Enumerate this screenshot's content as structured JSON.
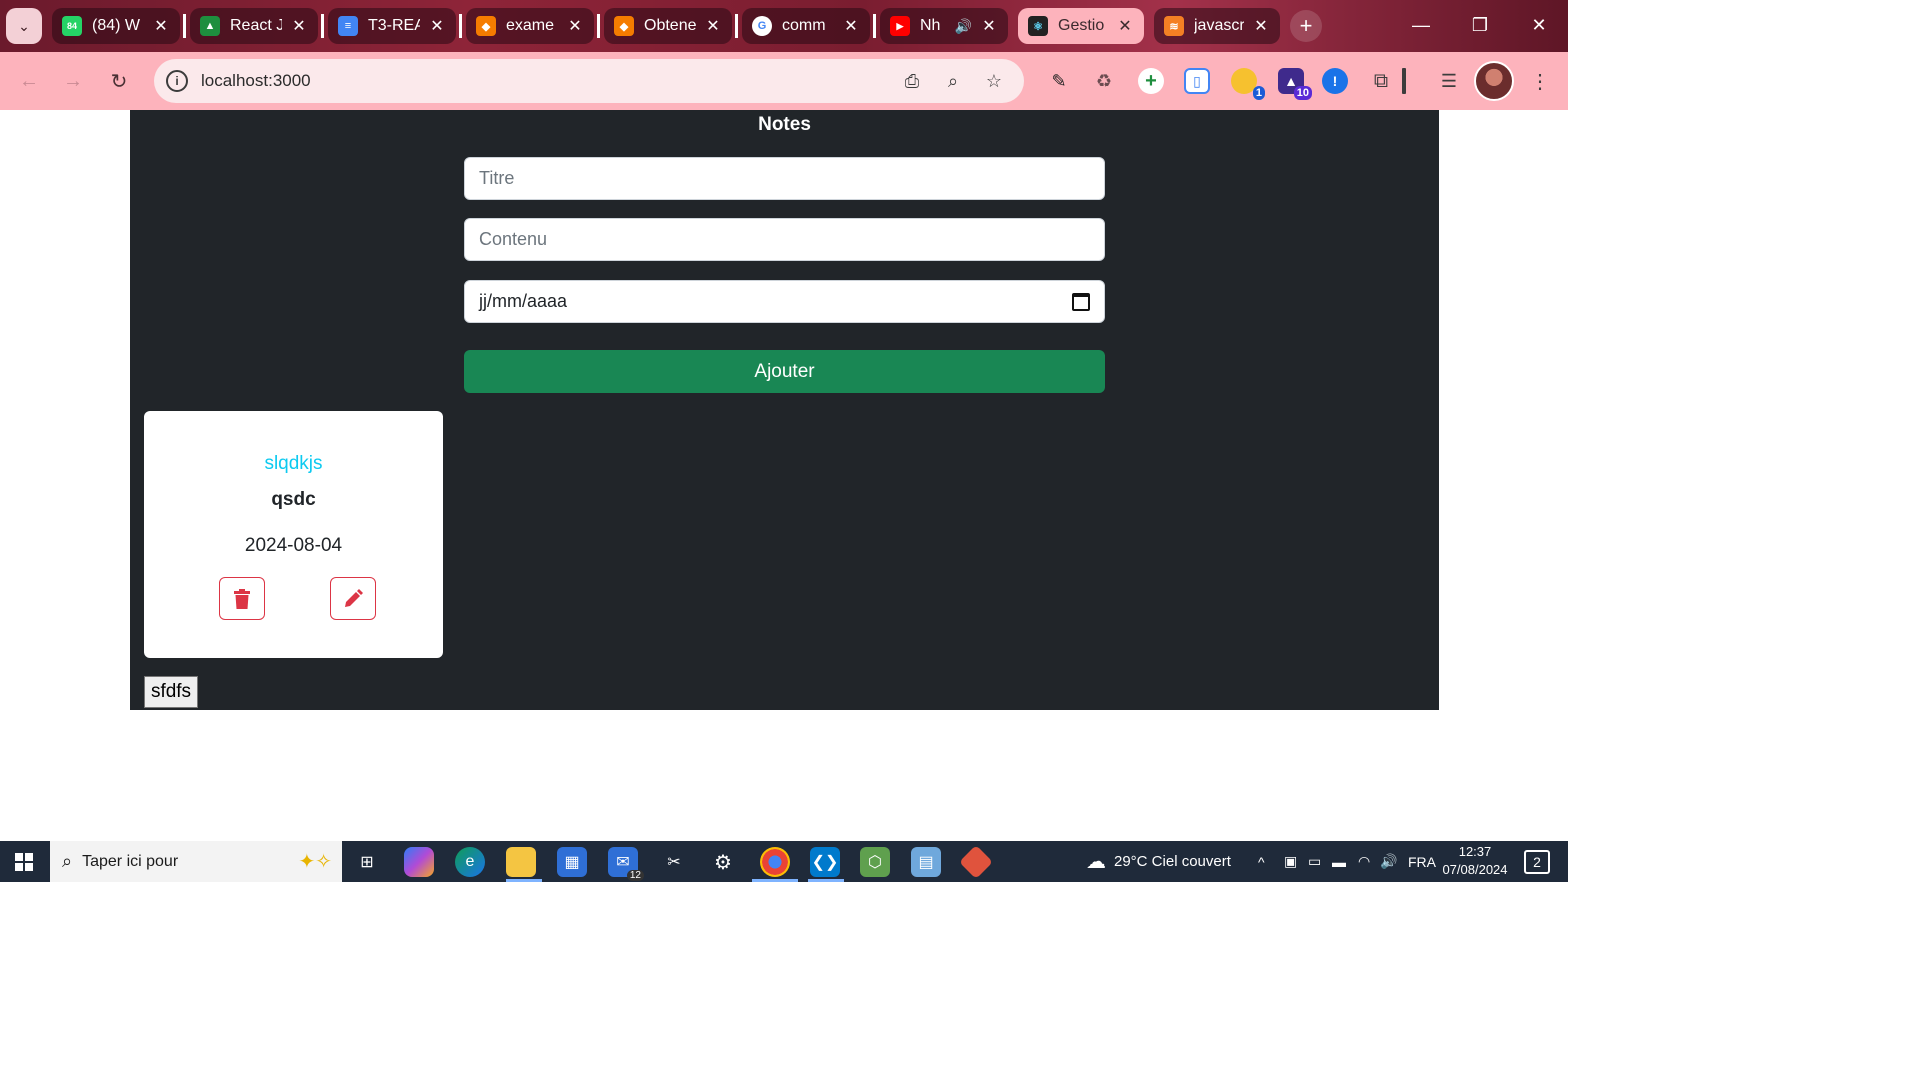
{
  "browser": {
    "tabs": [
      {
        "title": "(84) W",
        "favicon_text": "84",
        "favicon_color": "#25d366"
      },
      {
        "title": "React J",
        "favicon_text": "▲",
        "favicon_color": "#1e8e3e"
      },
      {
        "title": "T3-REA",
        "favicon_text": "≡",
        "favicon_color": "#4285f4"
      },
      {
        "title": "exame",
        "favicon_text": "◆",
        "favicon_color": "#f57c00"
      },
      {
        "title": "Obtene",
        "favicon_text": "◆",
        "favicon_color": "#f57c00"
      },
      {
        "title": "comm",
        "favicon_text": "G",
        "favicon_color": "#ffffff"
      },
      {
        "title": "Nh",
        "favicon_text": "▶",
        "favicon_color": "#ff0000"
      },
      {
        "title": "Gestio",
        "favicon_text": "⚛",
        "favicon_color": "#222222"
      },
      {
        "title": "javascr",
        "favicon_text": "≋",
        "favicon_color": "#f48024"
      }
    ],
    "url": "localhost:3000"
  },
  "app": {
    "title": "Notes",
    "title_placeholder": "Titre",
    "content_placeholder": "Contenu",
    "date_placeholder": "jj/mm/aaaa",
    "add_button": "Ajouter",
    "note": {
      "title": "slqdkjs",
      "content": "qsdc",
      "date": "2024-08-04"
    },
    "extra_button": "sfdfs"
  },
  "taskbar": {
    "search_placeholder": "Taper ici pour",
    "weather": "29°C  Ciel couvert",
    "language": "FRA",
    "time": "12:37",
    "date": "07/08/2024",
    "mail_badge": "12",
    "notification_count": "2"
  },
  "extensions": {
    "badge_1": "1",
    "badge_10": "10"
  },
  "colors": {
    "page_bg": "#212529",
    "success": "#198754",
    "info": "#0dcaf0",
    "danger": "#dc3545",
    "toolbar": "#fdb3bc"
  }
}
